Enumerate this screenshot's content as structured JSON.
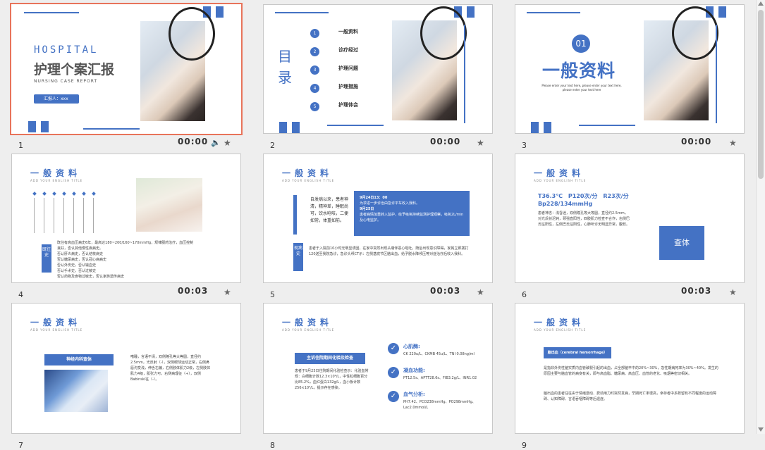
{
  "slides": [
    {
      "num": "1",
      "time": "00:00",
      "title_en": "HOSPITAL",
      "title_cn": "护理个案汇报",
      "subtitle": "NURSING CASE REPORT",
      "reporter": "汇报人：xxx"
    },
    {
      "num": "2",
      "time": "00:00",
      "heading": "目录",
      "items": [
        "一般资料",
        "诊疗经过",
        "护理问题",
        "护理措施",
        "护理体会"
      ],
      "item_nums": [
        "1",
        "2",
        "3",
        "4",
        "5"
      ]
    },
    {
      "num": "3",
      "time": "00:00",
      "badge": "01",
      "title": "一般资料",
      "body": "Please enter your text here, please enter your text here, please enter your text here"
    },
    {
      "num": "4",
      "time": "00:03",
      "title": "一般资料",
      "sub": "ADD YOUR ENGLISH TITLE",
      "side_label": "既往史",
      "body": "既往有高血压病史6年，最高达180~200/160~170mmHg，规律服药治疗，血压控制良好，否认其他慢性疾病史。",
      "bullets": [
        "否认肝炎病史，否认结核病史",
        "否认糖尿病史，否认冠心病病史",
        "否认外伤史，否认输血史",
        "否认手术史，否认过敏史",
        "否认药物及食物过敏史，否认家族遗传病史"
      ]
    },
    {
      "num": "5",
      "time": "00:03",
      "title": "一般资料",
      "sub": "ADD YOUR ENGLISH TITLE",
      "left_text": "自发病以来，患者神清，精神差，睡眠尚可，饮水呛咳，二便如常，体重如前。",
      "box_date1": "9月24日13：00",
      "box_text1": "为求进一步诊治由急诊平车收入我科。",
      "box_date2": "9月25日",
      "box_text2": "患者病情加重转入监护，给予吸氧持续监测护理观察，吸氧2L/min及心电监护。",
      "side_label": "现病史",
      "body": "患者于入院前10小时无明显诱因，在家中突然出现头痛伴恶心呕吐，随后出现意识障碍，家属立即拨打120送至我院急诊，急诊头颅CT示：左侧基底节区脑出血，给予脱水降颅压等对症治疗后收入我科。"
    },
    {
      "num": "6",
      "time": "00:03",
      "title": "一般资料",
      "sub": "ADD YOUR ENGLISH TITLE",
      "vitals": "T36.3℃　P120次/分　R23次/分",
      "bp": "Bp228/134mmHg",
      "body": "患者神志：浅昏迷，双侧瞳孔等大等圆，直径约2.5mm，对光反射迟钝，颈强直阳性，四肢肌力检查不合作，右侧巴氏征阳性，左侧巴氏征阴性，心肺听诊无明显异常，腹软。",
      "button": "查体"
    },
    {
      "num": "7",
      "title": "一般资料",
      "sub": "ADD YOUR ENGLISH TITLE",
      "box_label": "神经内科查体",
      "body": "嗜睡，言语不清，双侧瞳孔等大等圆，直径约2.5mm，光反射（-），双侧眼球运动正常，右侧鼻唇沟变浅，伸舌右偏，右侧肢体肌力2级，左侧肢体肌力4级，肌张力可，右侧病理征（+），双侧Babinski征（-）。"
    },
    {
      "num": "8",
      "title": "一般资料",
      "sub": "ADD YOUR ENGLISH TITLE",
      "box_label": "主诉住院期间化验及检查",
      "body": "患者于9月25日住院期间化验检查示：化验血常规：白细胞计数12.3×10⁹/L，中性粒细胞百分比85.2%，血红蛋白132g/L，血小板计数256×10⁹/L，提示存在感染。",
      "items": [
        {
          "label": "心肌酶:",
          "text": "CK 220u/L、CKMB 45u/L、TNI 0.08ng/ml"
        },
        {
          "label": "凝血功能:",
          "text": "PT12.5s、APTT28.6s、FIB3.2g/L、INR1.02"
        },
        {
          "label": "血气分析:",
          "text": "PH7.42、PCO238mmHg、PO298mmHg、Lac2.0mmol/L"
        }
      ]
    },
    {
      "num": "9",
      "title": "一般资料",
      "sub": "ADD YOUR ENGLISH TITLE",
      "box_label": "脑出血（cerebral hemorrhage）",
      "body": "是指非外伤性脑实质内血管破裂引起的出血，占全部脑卒中的20%~30%，急性期病死率为30%~40%。发生的原因主要与脑血管的病变有关，即与高血脂、糖尿病、高血压、血管的老化、吸烟等密切相关。",
      "body2": "脑出血的患者往往由于情绪激动、费劲用力时突然发病，早期死亡率很高，幸存者中多数留有不同程度的运动障碍、认知障碍、言语吞咽障碍等后遗症。"
    }
  ],
  "colors": {
    "accent": "#4472c4",
    "selected": "#e8735a"
  },
  "icons": {
    "speaker": "speaker-icon",
    "star": "star-icon",
    "check": "check-icon"
  }
}
